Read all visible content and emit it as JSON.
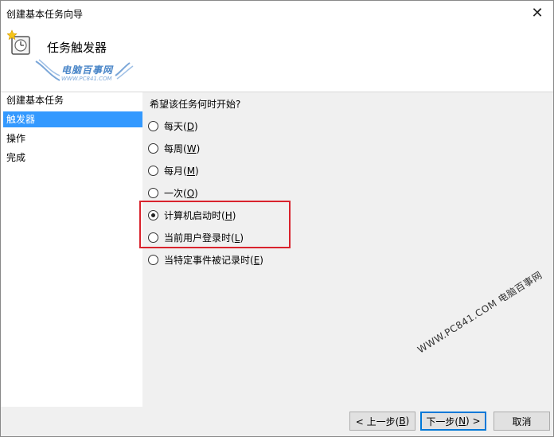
{
  "window": {
    "title": "创建基本任务向导"
  },
  "header": {
    "heading": "任务触发器"
  },
  "logo": {
    "text": "电脑百事网",
    "sub": "WWW.PC841.COM"
  },
  "nav": {
    "items": [
      {
        "label": "创建基本任务",
        "active": false
      },
      {
        "label": "触发器",
        "active": true
      },
      {
        "label": "操作",
        "active": false
      },
      {
        "label": "完成",
        "active": false
      }
    ]
  },
  "content": {
    "question": "希望该任务何时开始?",
    "options": [
      {
        "label": "每天(",
        "key": "D",
        "end": ")",
        "checked": false
      },
      {
        "label": "每周(",
        "key": "W",
        "end": ")",
        "checked": false
      },
      {
        "label": "每月(",
        "key": "M",
        "end": ")",
        "checked": false
      },
      {
        "label": "一次(",
        "key": "O",
        "end": ")",
        "checked": false
      },
      {
        "label": "计算机启动时(",
        "key": "H",
        "end": ")",
        "checked": true
      },
      {
        "label": "当前用户登录时(",
        "key": "L",
        "end": ")",
        "checked": false
      },
      {
        "label": "当特定事件被记录时(",
        "key": "E",
        "end": ")",
        "checked": false
      }
    ]
  },
  "watermark": {
    "text": "WWW.PC841.COM 电脑百事网"
  },
  "footer": {
    "back": {
      "pre": "< 上一步(",
      "key": "B",
      "end": ")"
    },
    "next": {
      "pre": "下一步(",
      "key": "N",
      "end": ") >"
    },
    "cancel": "取消"
  },
  "colors": {
    "selection": "#3399ff",
    "highlight": "#d9232d",
    "accent": "#0078d7"
  }
}
